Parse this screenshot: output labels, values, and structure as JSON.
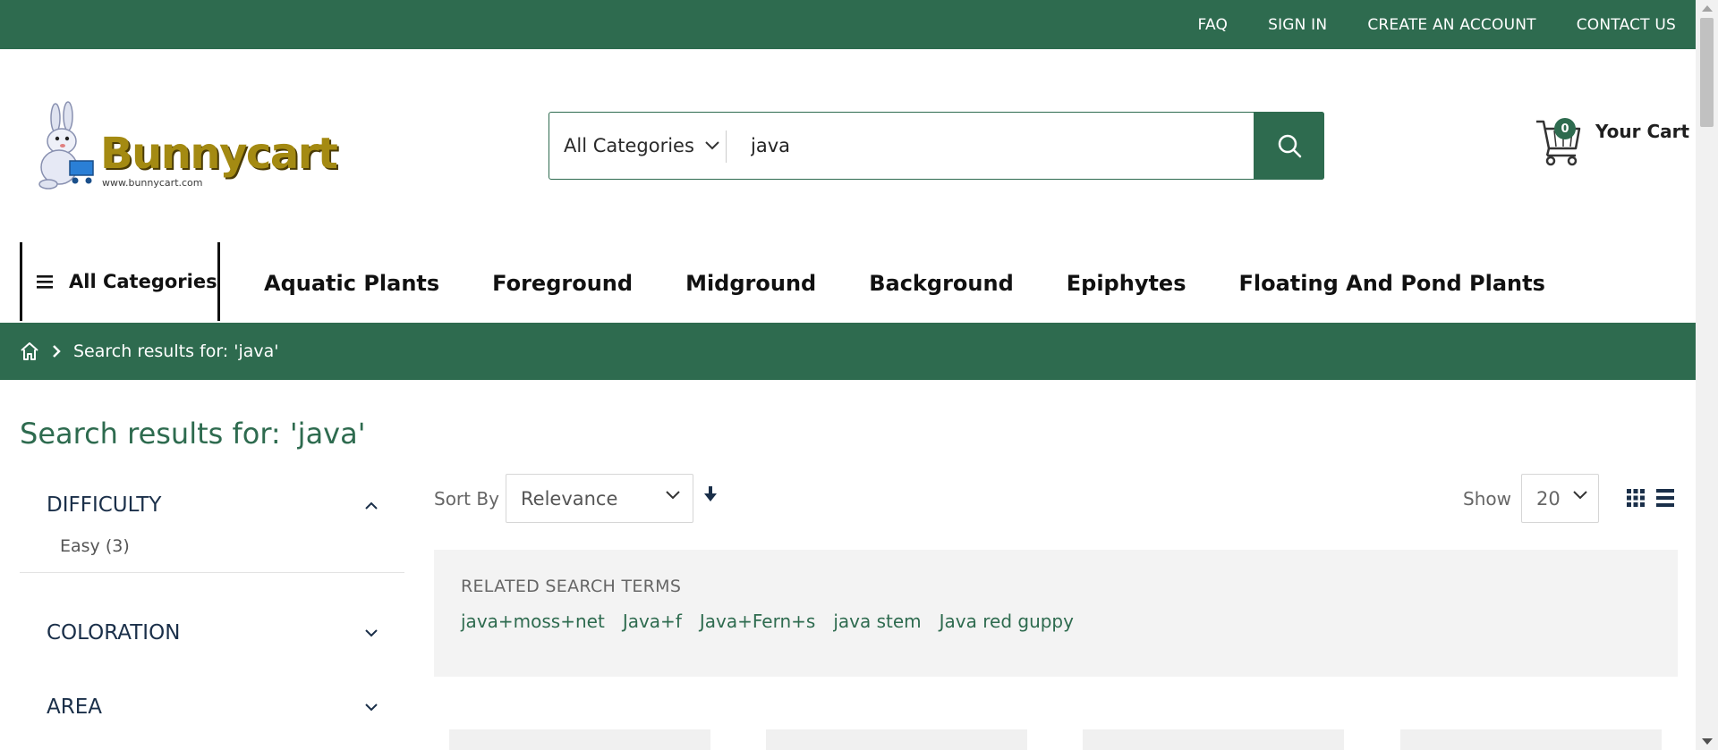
{
  "topbar": {
    "links": [
      "FAQ",
      "SIGN IN",
      "CREATE AN ACCOUNT",
      "CONTACT US"
    ]
  },
  "logo": {
    "name": "Bunnycart",
    "url_text": "www.bunnycart.com"
  },
  "search": {
    "category": "All Categories",
    "query": "java"
  },
  "cart": {
    "count": "0",
    "label": "Your Cart"
  },
  "nav": {
    "all_categories": "All Categories",
    "items": [
      "Aquatic Plants",
      "Foreground",
      "Midground",
      "Background",
      "Epiphytes",
      "Floating And Pond Plants"
    ]
  },
  "breadcrumb": {
    "current": "Search results for: 'java'"
  },
  "page_title": "Search results for: 'java'",
  "filters": [
    {
      "title": "DIFFICULTY",
      "expanded": true,
      "options": [
        "Easy (3)"
      ]
    },
    {
      "title": "COLORATION",
      "expanded": false
    },
    {
      "title": "AREA",
      "expanded": false
    }
  ],
  "toolbar": {
    "sort_label": "Sort By",
    "sort_value": "Relevance",
    "show_label": "Show",
    "show_value": "20"
  },
  "related": {
    "title": "RELATED SEARCH TERMS",
    "terms": [
      "java+moss+net",
      "Java+f",
      "Java+Fern+s",
      "java stem",
      "Java red guppy"
    ]
  },
  "colors": {
    "brand_green": "#2e6b4f",
    "logo_gold": "#a48a12"
  }
}
